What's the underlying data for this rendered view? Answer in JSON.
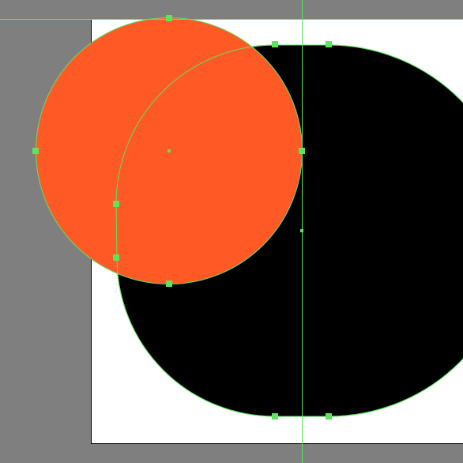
{
  "colors": {
    "pasteboard": "#7f7f7f",
    "artboard": "#ffffff",
    "artboard_border": "#000000",
    "circle_fill": "#ff5a26",
    "rounded_shape_fill": "#000000",
    "selection": "#5de35d"
  },
  "shapes": [
    {
      "name": "rounded-rect-shape",
      "kind": "rounded-rectangle",
      "selected": true
    },
    {
      "name": "orange-circle-shape",
      "kind": "ellipse",
      "selected": true
    }
  ],
  "guides": [
    {
      "name": "horizontal-guide",
      "orientation": "horizontal"
    },
    {
      "name": "vertical-guide",
      "orientation": "vertical"
    }
  ]
}
